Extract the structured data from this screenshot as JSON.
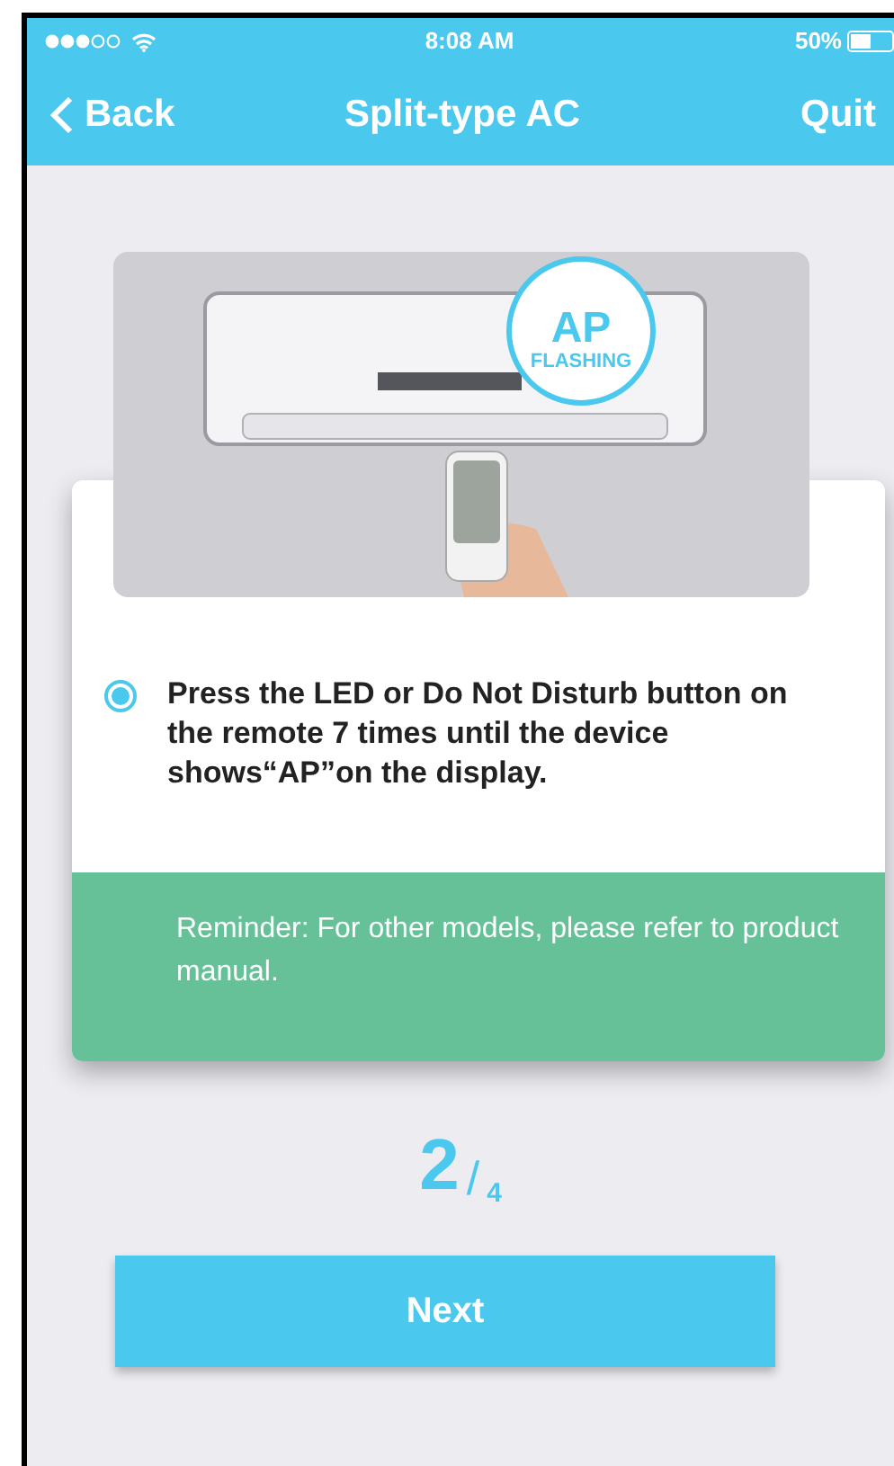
{
  "status_bar": {
    "time": "8:08 AM",
    "battery": "50%"
  },
  "nav": {
    "back": "Back",
    "title": "Split-type AC",
    "quit": "Quit"
  },
  "illustration": {
    "bubble_title": "AP",
    "bubble_subtitle": "FLASHING"
  },
  "instruction": {
    "selected": true,
    "text": "Press the LED or Do Not Disturb button on the remote 7 times until the device shows“AP”on the display."
  },
  "reminder": "Reminder: For other models, please refer to product manual.",
  "progress": {
    "current": "2",
    "separator": "/",
    "total": "4"
  },
  "next_button": "Next"
}
